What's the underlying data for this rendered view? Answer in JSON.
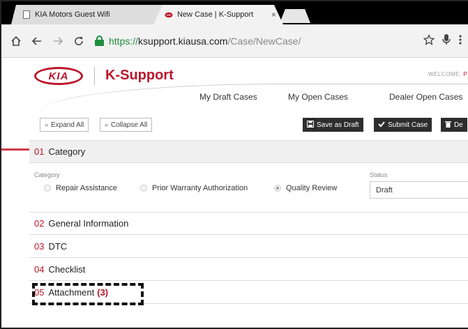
{
  "browser": {
    "tabs": [
      {
        "title": "KIA Motors Guest Wifi",
        "close": "×",
        "icon": "page-icon"
      },
      {
        "title": "New Case | K-Support",
        "close": "×",
        "icon": "kia-favicon"
      }
    ],
    "url": {
      "scheme": "https://",
      "host": "ksupport.kiausa.com",
      "path": "/Case/NewCase/"
    },
    "icons": [
      "home-icon",
      "back-icon",
      "forward-icon",
      "reload-icon",
      "lock-icon",
      "star-icon",
      "mic-icon",
      "menu-icon"
    ]
  },
  "site": {
    "logo_text": "KIA",
    "brand": "K-Support",
    "welcome": "WELCOME,",
    "welcome_name": "P",
    "nav": [
      "My Draft Cases",
      "My Open Cases",
      "Dealer Open Cases"
    ]
  },
  "actions": {
    "expand_all": "Expand All",
    "collapse_all": "Collapse All",
    "save_draft": "Save as Draft",
    "submit_case": "Submit Case",
    "delete": "De"
  },
  "sections": [
    {
      "num": "01",
      "title": "Category"
    },
    {
      "num": "02",
      "title": "General Information"
    },
    {
      "num": "03",
      "title": "DTC"
    },
    {
      "num": "04",
      "title": "Checklist"
    },
    {
      "num": "05",
      "title": "Attachment",
      "count": "(3)"
    }
  ],
  "category": {
    "label": "Category",
    "options": [
      {
        "label": "Repair Assistance",
        "selected": false
      },
      {
        "label": "Prior Warranty Authorization",
        "selected": false
      },
      {
        "label": "Quality Review",
        "selected": true
      }
    ],
    "status_label": "Status",
    "status_value": "Draft"
  },
  "colors": {
    "brand_red": "#bb162b",
    "accent_line": "#cf3a4c",
    "secure_green": "#1e8e3e",
    "button_dark": "#2d2d2d"
  }
}
